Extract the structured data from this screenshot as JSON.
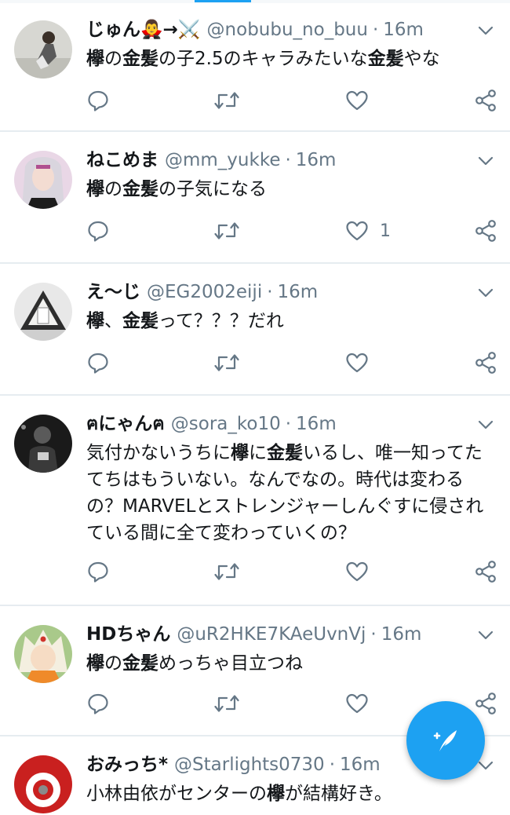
{
  "tweets": [
    {
      "name": "じゅん🧛‍♂️→⚔️",
      "handle": "@nobubu_no_buu",
      "time": "16m",
      "text_parts": [
        "",
        "欅",
        "の",
        "金髪",
        "の子2.5のキャラみたいな",
        "金髪",
        "やな"
      ],
      "like_count": ""
    },
    {
      "name": "ねこめま",
      "handle": "@mm_yukke",
      "time": "16m",
      "text_parts": [
        "",
        "欅",
        "の",
        "金髪",
        "の子気になる"
      ],
      "like_count": "1"
    },
    {
      "name": "え〜じ",
      "handle": "@EG2002eiji",
      "time": "16m",
      "text_parts": [
        "",
        "欅",
        "、",
        "金髪",
        "って？？？だれ"
      ],
      "like_count": ""
    },
    {
      "name": "ฅにゃんฅ",
      "handle": "@sora_ko10",
      "time": "16m",
      "text_parts": [
        "気付かないうちに",
        "欅",
        "に",
        "金髪",
        "いるし、唯一知ってたてちはもういない。なんでなの。時代は変わるの？MARVELとストレンジャーしんぐすに侵されている間に全て変わっていくの？"
      ],
      "like_count": ""
    },
    {
      "name": "HDちゃん",
      "handle": "@uR2HKE7KAeUvnVj",
      "time": "16m",
      "text_parts": [
        "",
        "欅",
        "の",
        "金髪",
        "めっちゃ目立つね"
      ],
      "like_count": ""
    },
    {
      "name": "おみっち*",
      "handle": "@Starlights0730",
      "time": "16m",
      "text_parts": [
        "小林由依がセンターの",
        "欅",
        "が結構好き。"
      ],
      "like_count": ""
    }
  ],
  "separator": "·",
  "colors": {
    "accent": "#1da1f2",
    "secondary_text": "#657786",
    "divider": "#e6ecf0"
  },
  "icons": [
    "reply-icon",
    "retweet-icon",
    "like-icon",
    "share-icon",
    "chevron-down-icon",
    "compose-icon"
  ]
}
